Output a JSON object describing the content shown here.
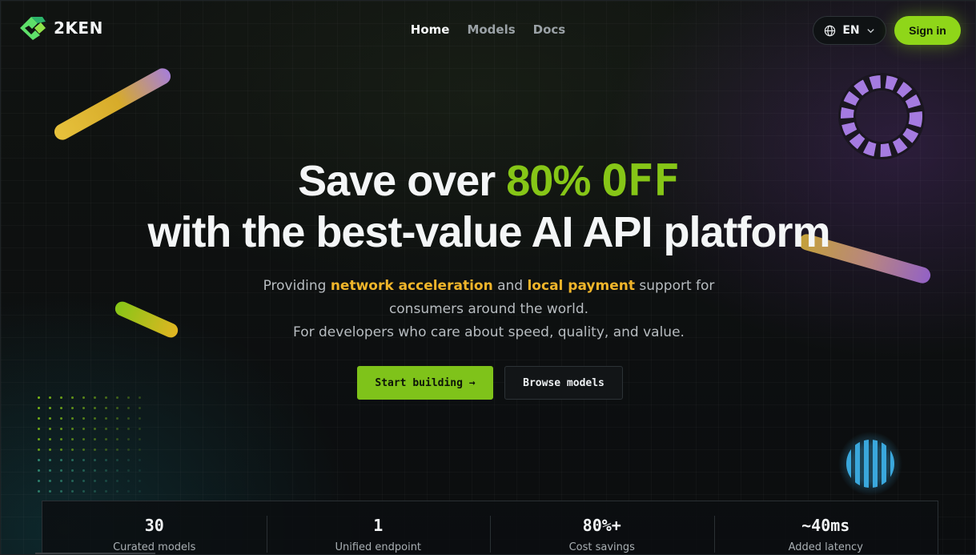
{
  "brand": {
    "name": "2KEN"
  },
  "nav": {
    "items": [
      {
        "label": "Home",
        "active": true
      },
      {
        "label": "Models",
        "active": false
      },
      {
        "label": "Docs",
        "active": false
      }
    ],
    "language": "EN",
    "language_icon": "globe-icon",
    "signin_label": "Sign in"
  },
  "hero": {
    "line1_prefix": "Save over ",
    "line1_accent_pct": "80%",
    "line1_accent_off": "OFF",
    "line2": "with the best-value AI API platform",
    "sub1_pre": "Providing ",
    "sub1_hl1": "network acceleration",
    "sub1_mid": " and ",
    "sub1_hl2": "local payment",
    "sub1_post": " support for",
    "sub2": "consumers around the world.",
    "sub3": "For developers who care about speed, quality, and value.",
    "cta_primary": "Start building →",
    "cta_secondary": "Browse models"
  },
  "stats": [
    {
      "value": "30",
      "label": "Curated models"
    },
    {
      "value": "1",
      "label": "Unified endpoint"
    },
    {
      "value": "80%+",
      "label": "Cost savings"
    },
    {
      "value": "~40ms",
      "label": "Added latency"
    }
  ],
  "colors": {
    "accent_green": "#86c617",
    "highlight_amber": "#f0b52a",
    "decor_purple": "#a57be0",
    "decor_blue": "#3aa7dc"
  }
}
